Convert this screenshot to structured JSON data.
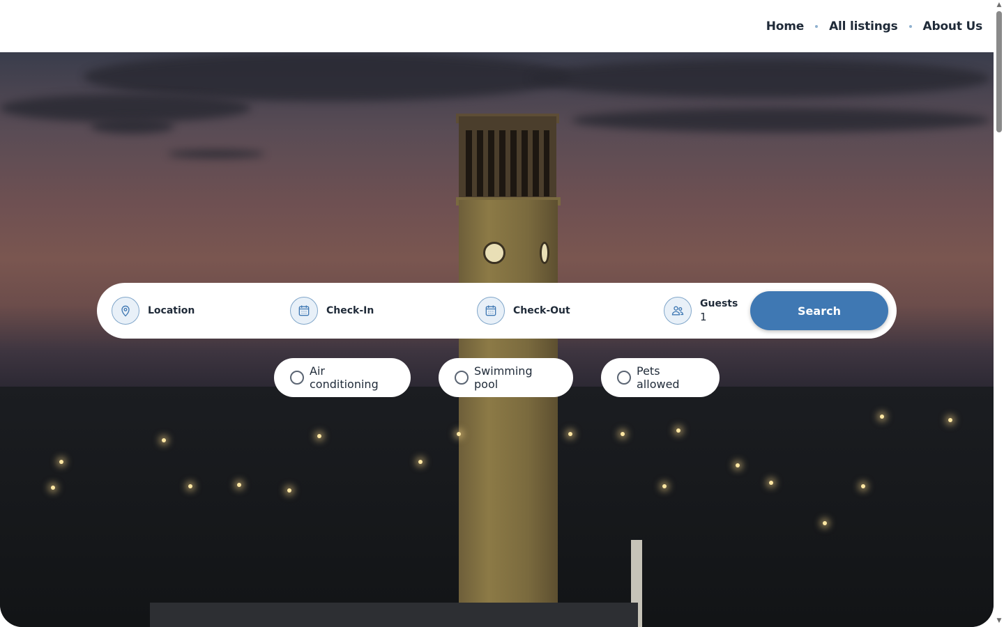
{
  "nav": {
    "home": "Home",
    "listings": "All listings",
    "about": "About Us"
  },
  "search": {
    "location_label": "Location",
    "checkin_label": "Check-In",
    "checkout_label": "Check-Out",
    "guests_label": "Guests",
    "guests_value": "1",
    "button_label": "Search"
  },
  "filters": [
    {
      "label": "Air conditioning",
      "checked": false
    },
    {
      "label": "Swimming pool",
      "checked": false
    },
    {
      "label": "Pets allowed",
      "checked": false
    }
  ],
  "colors": {
    "accent": "#3f78b3",
    "icon_bg": "#e8f0f8",
    "icon_border": "#7fa5c9",
    "text": "#1f2a38"
  },
  "icons": {
    "location": "map-pin-icon",
    "checkin": "calendar-icon",
    "checkout": "calendar-icon",
    "guests": "users-icon"
  }
}
